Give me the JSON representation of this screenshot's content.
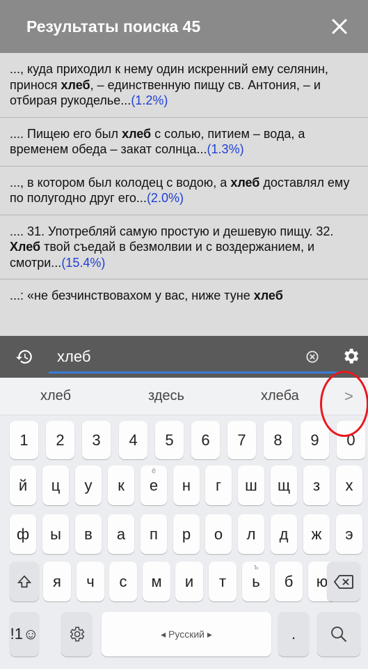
{
  "header": {
    "title": "Результаты поиска 45"
  },
  "results": [
    {
      "pre": "..., куда приходил к нему один искренний ему селянин, принося ",
      "bold": "хлеб",
      "post": ", – единственную пищу св. Антония, – и отбирая рукоделье...",
      "pct": "(1.2%)"
    },
    {
      "pre": ".... Пищею его был ",
      "bold": "хлеб",
      "post": " с солью, питием – вода, а временем обеда – закат солнца...",
      "pct": "(1.3%)"
    },
    {
      "pre": "..., в котором был колодец с водою, а ",
      "bold": "хлеб",
      "post": " доставлял ему по полугодно друг его...",
      "pct": "(2.0%)"
    },
    {
      "pre": ".... 31. Употребляй самую простую и дешевую пищу. 32. ",
      "bold": "Хлеб",
      "post": " твой съедай в безмолвии и с воздержанием, и смотри...",
      "pct": "(15.4%)"
    },
    {
      "pre": "...: «не безчинствовахом у вас, ниже туне ",
      "bold": "хлеб",
      "post": "",
      "pct": ""
    }
  ],
  "search": {
    "value": "хлеб"
  },
  "suggestions": [
    "хлеб",
    "здесь",
    "хлеба",
    ">"
  ],
  "keys": {
    "row1": [
      "1",
      "2",
      "3",
      "4",
      "5",
      "6",
      "7",
      "8",
      "9",
      "0"
    ],
    "row2": [
      "й",
      "ц",
      "у",
      "к",
      "е",
      "н",
      "г",
      "ш",
      "щ",
      "з",
      "х"
    ],
    "row2_sup": {
      "4": "ё"
    },
    "row3": [
      "ф",
      "ы",
      "в",
      "а",
      "п",
      "р",
      "о",
      "л",
      "д",
      "ж",
      "э"
    ],
    "row4": [
      "я",
      "ч",
      "с",
      "м",
      "и",
      "т",
      "ь",
      "б",
      "ю"
    ],
    "row4_sup": {
      "6": "ъ"
    },
    "symbols": "!1☺",
    "space": "◂ Русский ▸",
    "period": "."
  },
  "colors": {
    "accent": "#3a7bd8",
    "highlight_circle": "#e8181f",
    "percent": "#1e3fd6"
  }
}
